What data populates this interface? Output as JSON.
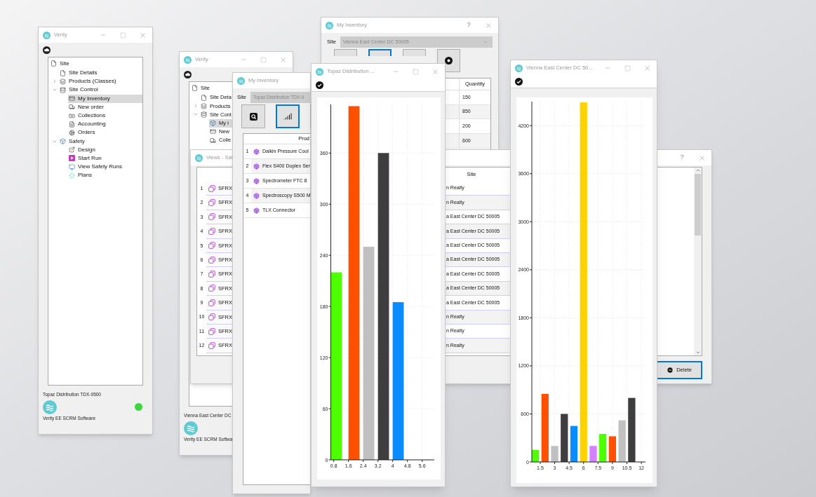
{
  "windows": [
    {
      "kind": "navigator",
      "title": "Verity",
      "tree": [
        {
          "label": "Site",
          "selected": false,
          "children": [
            {
              "label": "Site Details",
              "selected": false
            },
            {
              "label": "Products (Classes)",
              "selected": false,
              "expanded": false
            },
            {
              "label": "Site Control",
              "selected": false,
              "expanded": true,
              "children": [
                {
                  "label": "My Inventory",
                  "selected": true
                },
                {
                  "label": "New order",
                  "selected": false
                },
                {
                  "label": "Collections",
                  "selected": false
                },
                {
                  "label": "Accounting",
                  "selected": false
                },
                {
                  "label": "Orders",
                  "selected": false
                }
              ]
            },
            {
              "label": "Safety",
              "selected": false,
              "expanded": true,
              "children": [
                {
                  "label": "Design",
                  "selected": false
                },
                {
                  "label": "Start Run",
                  "selected": false
                },
                {
                  "label": "View Safety Runs",
                  "selected": false
                },
                {
                  "label": "Plans",
                  "selected": false
                }
              ]
            }
          ]
        }
      ],
      "site_name": "Topaz Distribution TDX-9500",
      "product": "Verity EE SCRM Software",
      "connected": true
    },
    {
      "kind": "navigator",
      "title": "Verity",
      "tree": [
        {
          "label": "Site",
          "selected": false,
          "children": [
            {
              "label": "Site Deta",
              "selected": false
            },
            {
              "label": "Products",
              "selected": false,
              "expanded": false
            },
            {
              "label": "Site Cont",
              "selected": false,
              "expanded": true,
              "children": [
                {
                  "label": "My I",
                  "selected": true
                },
                {
                  "label": "New",
                  "selected": false
                },
                {
                  "label": "Colle",
                  "selected": false
                }
              ]
            }
          ]
        }
      ],
      "site_name": "Vienna East Center DC",
      "product": "Verity EE SCRM Softwa"
    },
    {
      "kind": "inventory",
      "title": "My Inventory",
      "help": "?",
      "site_label": "Site",
      "site": "Vienna East Center DC 50005",
      "toolbar": [
        {
          "selected": false
        },
        {
          "selected": true
        },
        {
          "selected": false
        },
        {
          "selected": false
        }
      ],
      "columns": [
        "Quantity"
      ],
      "rows": [
        {
          "cells": [
            "150"
          ]
        },
        {
          "cells": [
            "850"
          ]
        },
        {
          "cells": [
            "200"
          ]
        },
        {
          "cells": [
            "600"
          ]
        }
      ]
    },
    {
      "kind": "views",
      "title": "Views - Saf",
      "help": "?",
      "site_column": "Site",
      "rows": [
        {
          "number": "1",
          "name": "SFRX",
          "site": "n Realty"
        },
        {
          "number": "2",
          "name": "SFRX",
          "site": "n Realty"
        },
        {
          "number": "3",
          "name": "SFRX",
          "site": "a East Center DC 50005"
        },
        {
          "number": "4",
          "name": "SFRX",
          "site": "a East Center DC 50005"
        },
        {
          "number": "5",
          "name": "SFRX",
          "site": "a East Center DC 50005"
        },
        {
          "number": "6",
          "name": "SFRX",
          "site": "a East Center DC 50005"
        },
        {
          "number": "7",
          "name": "SFRX",
          "site": "a East Center DC 50005"
        },
        {
          "number": "8",
          "name": "SFRX",
          "site": "a East Center DC 50005"
        },
        {
          "number": "9",
          "name": "SFRX",
          "site": "a East Center DC 50005"
        },
        {
          "number": "10",
          "name": "SFRX",
          "site": "n Realty"
        },
        {
          "number": "11",
          "name": "SFRX",
          "site": "n Realty"
        },
        {
          "number": "12",
          "name": "SFRX",
          "site": "n Realty"
        }
      ],
      "delete": "Delete"
    },
    {
      "kind": "inventory",
      "title": "My Inventory",
      "site_label": "Site",
      "site": "Topaz Distribution TDX-9",
      "toolbar": [
        {
          "selected": false
        },
        {
          "selected": true
        },
        {
          "selected": false
        }
      ],
      "columns": [
        "Prod"
      ],
      "rows": [
        {
          "number": "1",
          "cells": [
            "Daikin Pressure Cool"
          ]
        },
        {
          "number": "2",
          "cells": [
            "Flex S400 Duplex Ser"
          ]
        },
        {
          "number": "3",
          "cells": [
            "Spectrometer FTC 8"
          ]
        },
        {
          "number": "4",
          "cells": [
            "Spectroscopy S500 M"
          ]
        },
        {
          "number": "5",
          "cells": [
            "TLX Connector"
          ]
        }
      ]
    },
    {
      "kind": "chart",
      "title": "Topaz Distribution ...",
      "chart_data": {
        "type": "bar",
        "x": [
          0.94,
          1.9,
          2.7,
          3.5,
          4.3
        ],
        "series": [
          {
            "color": "#4dff00",
            "values": [
              220,
              null,
              null,
              null,
              null
            ]
          },
          {
            "color": "#ff5000",
            "values": [
              null,
              415,
              null,
              null,
              null
            ]
          },
          {
            "color": "#c0c0c0",
            "values": [
              null,
              null,
              250,
              null,
              null
            ]
          },
          {
            "color": "#3f3d40",
            "values": [
              null,
              null,
              null,
              360,
              null
            ]
          },
          {
            "color": "#0a8cff",
            "values": [
              null,
              null,
              null,
              null,
              185
            ]
          }
        ],
        "xlim": [
          0.64,
          6.26
        ],
        "ylim": [
          0,
          417
        ],
        "xticks": [
          0.8,
          1.6,
          2.4,
          3.2,
          4,
          4.8,
          5.6
        ],
        "yticks": [
          0,
          60,
          120,
          180,
          240,
          300,
          360
        ],
        "grid": true
      }
    },
    {
      "kind": "chart",
      "title": "Vienna East Center DC 50...",
      "chart_data": {
        "type": "bar",
        "x": [
          1,
          2,
          3,
          4,
          5,
          6,
          7,
          8,
          9,
          10,
          11
        ],
        "series": [
          {
            "color": "#4dff00",
            "values": [
              150,
              null,
              null,
              null,
              null,
              null,
              null,
              350,
              null,
              null,
              null
            ]
          },
          {
            "color": "#ff5000",
            "values": [
              null,
              850,
              null,
              null,
              null,
              null,
              null,
              null,
              320,
              null,
              null
            ]
          },
          {
            "color": "#c0c0c0",
            "values": [
              null,
              null,
              200,
              null,
              null,
              null,
              null,
              null,
              null,
              520,
              null
            ]
          },
          {
            "color": "#3f3d40",
            "values": [
              null,
              null,
              null,
              600,
              null,
              null,
              null,
              null,
              null,
              null,
              800
            ]
          },
          {
            "color": "#0a8cff",
            "values": [
              null,
              null,
              null,
              null,
              450,
              null,
              null,
              null,
              null,
              null,
              null
            ]
          },
          {
            "color": "#ffd300",
            "values": [
              null,
              null,
              null,
              null,
              null,
              4490,
              null,
              null,
              null,
              null,
              null
            ]
          },
          {
            "color": "#d580ff",
            "values": [
              null,
              null,
              null,
              null,
              null,
              null,
              200,
              null,
              null,
              null,
              null
            ]
          }
        ],
        "xlim": [
          0.63,
          12.43
        ],
        "ylim": [
          0,
          4500
        ],
        "xticks": [
          1.5,
          3,
          4.5,
          6,
          7.5,
          9,
          10.5,
          12
        ],
        "yticks": [
          0,
          600,
          1200,
          1800,
          2400,
          3000,
          3600,
          4200
        ],
        "grid": true
      }
    }
  ]
}
